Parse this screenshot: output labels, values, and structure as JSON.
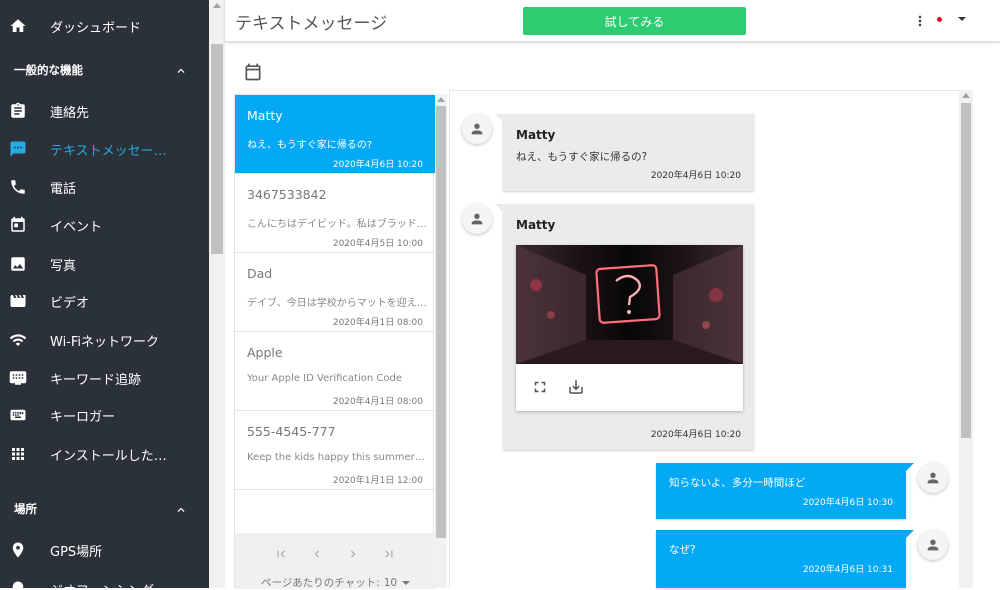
{
  "sidebar": {
    "top_item": {
      "label": "ダッシュボード",
      "icon": "home-icon"
    },
    "section_general": {
      "label": "一般的な機能",
      "icon": "chevron-up-icon"
    },
    "items": [
      {
        "label": "連絡先",
        "icon": "contacts-icon"
      },
      {
        "label": "テキストメッセー…",
        "icon": "message-icon",
        "active": true
      },
      {
        "label": "電話",
        "icon": "phone-icon"
      },
      {
        "label": "イベント",
        "icon": "event-icon"
      },
      {
        "label": "写真",
        "icon": "photo-icon"
      },
      {
        "label": "ビデオ",
        "icon": "video-icon"
      },
      {
        "label": "Wi-Fiネットワーク",
        "icon": "wifi-icon"
      },
      {
        "label": "キーワード追跡",
        "icon": "keyword-icon"
      },
      {
        "label": "キーロガー",
        "icon": "keyboard-icon"
      },
      {
        "label": "インストールした…",
        "icon": "apps-grid-icon"
      }
    ],
    "section_location": {
      "label": "場所",
      "icon": "chevron-up-icon"
    },
    "location_items": [
      {
        "label": "GPS場所",
        "icon": "location-pin-icon"
      },
      {
        "label": "ジオフェンシング",
        "icon": "geofence-icon"
      }
    ]
  },
  "header": {
    "title": "テキストメッセージ",
    "try_button": "試してみる",
    "more_icon": "more-vert-icon",
    "flag": "japan-flag-icon",
    "dropdown": "caret-down-icon"
  },
  "toolbar": {
    "calendar_icon": "calendar-icon"
  },
  "chats": [
    {
      "name": "Matty",
      "preview": "ねえ、もうすぐ家に帰るの?",
      "time": "2020年4月6日 10:20",
      "active": true
    },
    {
      "name": "3467533842",
      "preview": "こんにちはデイビッド。私はブラッドです。",
      "time": "2020年4月5日 10:00"
    },
    {
      "name": "Dad",
      "preview": "デイブ、今日は学校からマットを迎えに行って",
      "time": "2020年4月1日 08:00"
    },
    {
      "name": "Apple",
      "preview": "Your Apple ID Verification Code",
      "time": "2020年4月1日 08:00"
    },
    {
      "name": "555-4545-777",
      "preview": "Keep the kids happy this summer with",
      "time": "2020年1月1日 12:00"
    }
  ],
  "pagination": {
    "first_icon": "first-page-icon",
    "prev_icon": "chevron-left-icon",
    "next_icon": "chevron-right-icon",
    "last_icon": "last-page-icon",
    "per_page_label": "ページあたりのチャット:",
    "per_page_value": "10"
  },
  "messages": [
    {
      "direction": "in",
      "sender": "Matty",
      "text": "ねえ、もうすぐ家に帰るの?",
      "time": "2020年4月6日 10:20"
    },
    {
      "direction": "in",
      "sender": "Matty",
      "media": "image",
      "time": "2020年4月6日 10:20",
      "actions": [
        "fullscreen-icon",
        "download-icon"
      ]
    },
    {
      "direction": "out",
      "text": "知らないよ、多分一時間ほど",
      "time": "2020年4月6日 10:30"
    },
    {
      "direction": "out",
      "text": "なぜ?",
      "time": "2020年4月6日 10:31"
    }
  ],
  "colors": {
    "sidebar_bg": "#2b3138",
    "active_text": "#29a9e1",
    "active_chat": "#03a9f4",
    "try_button": "#2ecc71",
    "incoming_bubble": "#ebebeb",
    "outgoing_bubble": "#03a9f4"
  }
}
